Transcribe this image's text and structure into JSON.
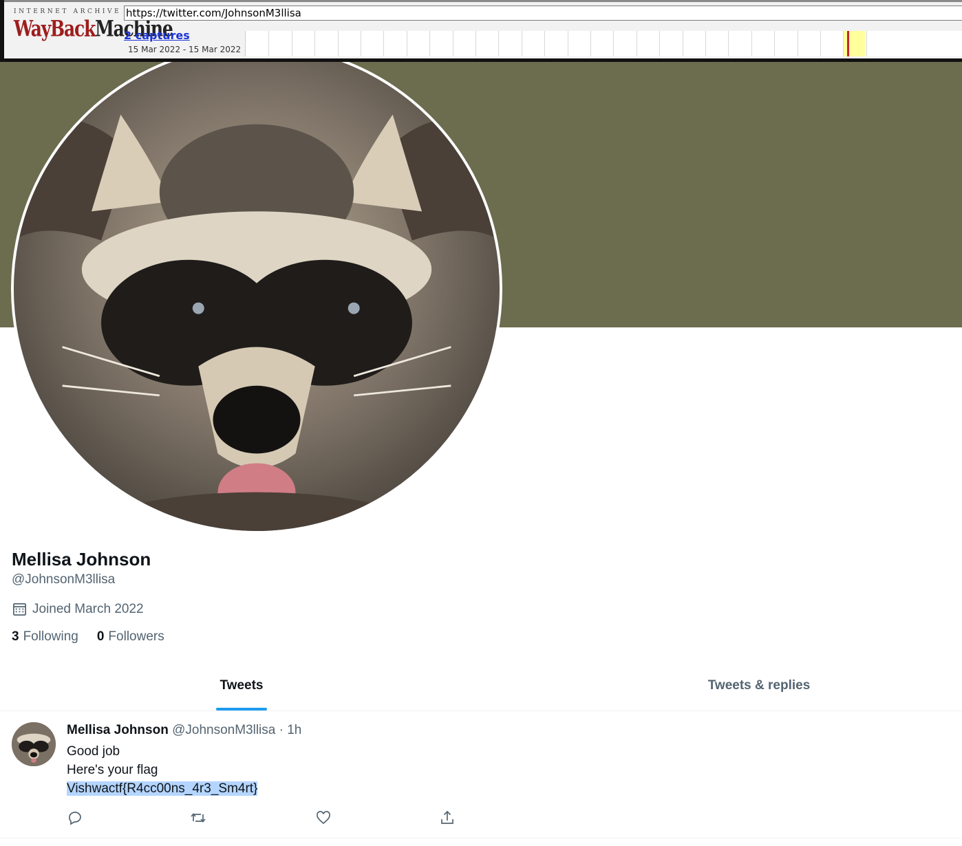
{
  "wayback": {
    "logo_top": "INTERNET ARCHIVE",
    "logo_main_1": "WayBack",
    "logo_main_2": "Machine",
    "url": "https://twitter.com/JohnsonM3llisa",
    "captures": "2 captures",
    "date_range": "15 Mar 2022 - 15 Mar 2022",
    "accent_color": "#9e1d1d"
  },
  "profile": {
    "banner_color": "#6c6c4f",
    "avatar_icon": "raccoon-avatar",
    "display_name": "Mellisa Johnson",
    "handle": "@JohnsonM3llisa",
    "joined_icon": "calendar-icon",
    "joined": "Joined March 2022",
    "following_count": "3",
    "following_label": "Following",
    "followers_count": "0",
    "followers_label": "Followers"
  },
  "tabs": [
    {
      "label": "Tweets",
      "active": true
    },
    {
      "label": "Tweets & replies",
      "active": false
    }
  ],
  "tweet": {
    "author_name": "Mellisa Johnson",
    "author_meta": "@JohnsonM3llisa · 1h",
    "lines": [
      "Good job",
      "Here's your flag",
      "Vishwactf{R4cc00ns_4r3_Sm4rt}"
    ],
    "actions": [
      "reply-icon",
      "retweet-icon",
      "like-icon",
      "share-icon"
    ],
    "accent_color": "#1d9bf0"
  }
}
